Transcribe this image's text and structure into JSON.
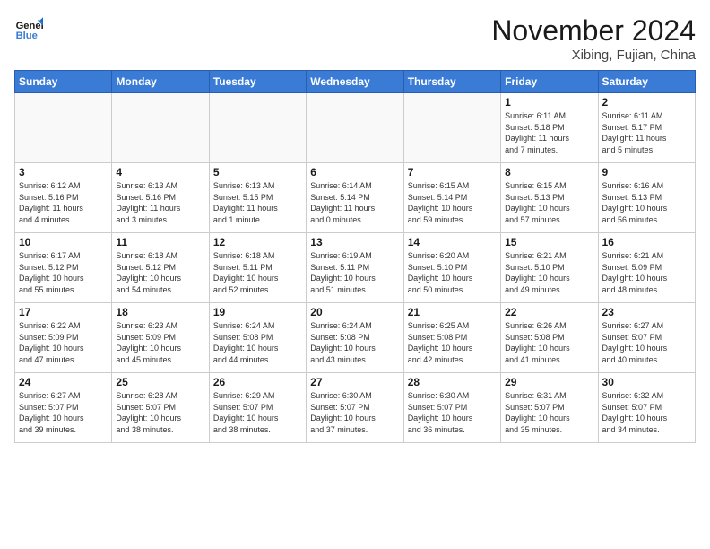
{
  "logo": {
    "line1": "General",
    "line2": "Blue"
  },
  "title": "November 2024",
  "location": "Xibing, Fujian, China",
  "weekdays": [
    "Sunday",
    "Monday",
    "Tuesday",
    "Wednesday",
    "Thursday",
    "Friday",
    "Saturday"
  ],
  "weeks": [
    [
      {
        "day": "",
        "info": ""
      },
      {
        "day": "",
        "info": ""
      },
      {
        "day": "",
        "info": ""
      },
      {
        "day": "",
        "info": ""
      },
      {
        "day": "",
        "info": ""
      },
      {
        "day": "1",
        "info": "Sunrise: 6:11 AM\nSunset: 5:18 PM\nDaylight: 11 hours\nand 7 minutes."
      },
      {
        "day": "2",
        "info": "Sunrise: 6:11 AM\nSunset: 5:17 PM\nDaylight: 11 hours\nand 5 minutes."
      }
    ],
    [
      {
        "day": "3",
        "info": "Sunrise: 6:12 AM\nSunset: 5:16 PM\nDaylight: 11 hours\nand 4 minutes."
      },
      {
        "day": "4",
        "info": "Sunrise: 6:13 AM\nSunset: 5:16 PM\nDaylight: 11 hours\nand 3 minutes."
      },
      {
        "day": "5",
        "info": "Sunrise: 6:13 AM\nSunset: 5:15 PM\nDaylight: 11 hours\nand 1 minute."
      },
      {
        "day": "6",
        "info": "Sunrise: 6:14 AM\nSunset: 5:14 PM\nDaylight: 11 hours\nand 0 minutes."
      },
      {
        "day": "7",
        "info": "Sunrise: 6:15 AM\nSunset: 5:14 PM\nDaylight: 10 hours\nand 59 minutes."
      },
      {
        "day": "8",
        "info": "Sunrise: 6:15 AM\nSunset: 5:13 PM\nDaylight: 10 hours\nand 57 minutes."
      },
      {
        "day": "9",
        "info": "Sunrise: 6:16 AM\nSunset: 5:13 PM\nDaylight: 10 hours\nand 56 minutes."
      }
    ],
    [
      {
        "day": "10",
        "info": "Sunrise: 6:17 AM\nSunset: 5:12 PM\nDaylight: 10 hours\nand 55 minutes."
      },
      {
        "day": "11",
        "info": "Sunrise: 6:18 AM\nSunset: 5:12 PM\nDaylight: 10 hours\nand 54 minutes."
      },
      {
        "day": "12",
        "info": "Sunrise: 6:18 AM\nSunset: 5:11 PM\nDaylight: 10 hours\nand 52 minutes."
      },
      {
        "day": "13",
        "info": "Sunrise: 6:19 AM\nSunset: 5:11 PM\nDaylight: 10 hours\nand 51 minutes."
      },
      {
        "day": "14",
        "info": "Sunrise: 6:20 AM\nSunset: 5:10 PM\nDaylight: 10 hours\nand 50 minutes."
      },
      {
        "day": "15",
        "info": "Sunrise: 6:21 AM\nSunset: 5:10 PM\nDaylight: 10 hours\nand 49 minutes."
      },
      {
        "day": "16",
        "info": "Sunrise: 6:21 AM\nSunset: 5:09 PM\nDaylight: 10 hours\nand 48 minutes."
      }
    ],
    [
      {
        "day": "17",
        "info": "Sunrise: 6:22 AM\nSunset: 5:09 PM\nDaylight: 10 hours\nand 47 minutes."
      },
      {
        "day": "18",
        "info": "Sunrise: 6:23 AM\nSunset: 5:09 PM\nDaylight: 10 hours\nand 45 minutes."
      },
      {
        "day": "19",
        "info": "Sunrise: 6:24 AM\nSunset: 5:08 PM\nDaylight: 10 hours\nand 44 minutes."
      },
      {
        "day": "20",
        "info": "Sunrise: 6:24 AM\nSunset: 5:08 PM\nDaylight: 10 hours\nand 43 minutes."
      },
      {
        "day": "21",
        "info": "Sunrise: 6:25 AM\nSunset: 5:08 PM\nDaylight: 10 hours\nand 42 minutes."
      },
      {
        "day": "22",
        "info": "Sunrise: 6:26 AM\nSunset: 5:08 PM\nDaylight: 10 hours\nand 41 minutes."
      },
      {
        "day": "23",
        "info": "Sunrise: 6:27 AM\nSunset: 5:07 PM\nDaylight: 10 hours\nand 40 minutes."
      }
    ],
    [
      {
        "day": "24",
        "info": "Sunrise: 6:27 AM\nSunset: 5:07 PM\nDaylight: 10 hours\nand 39 minutes."
      },
      {
        "day": "25",
        "info": "Sunrise: 6:28 AM\nSunset: 5:07 PM\nDaylight: 10 hours\nand 38 minutes."
      },
      {
        "day": "26",
        "info": "Sunrise: 6:29 AM\nSunset: 5:07 PM\nDaylight: 10 hours\nand 38 minutes."
      },
      {
        "day": "27",
        "info": "Sunrise: 6:30 AM\nSunset: 5:07 PM\nDaylight: 10 hours\nand 37 minutes."
      },
      {
        "day": "28",
        "info": "Sunrise: 6:30 AM\nSunset: 5:07 PM\nDaylight: 10 hours\nand 36 minutes."
      },
      {
        "day": "29",
        "info": "Sunrise: 6:31 AM\nSunset: 5:07 PM\nDaylight: 10 hours\nand 35 minutes."
      },
      {
        "day": "30",
        "info": "Sunrise: 6:32 AM\nSunset: 5:07 PM\nDaylight: 10 hours\nand 34 minutes."
      }
    ]
  ]
}
